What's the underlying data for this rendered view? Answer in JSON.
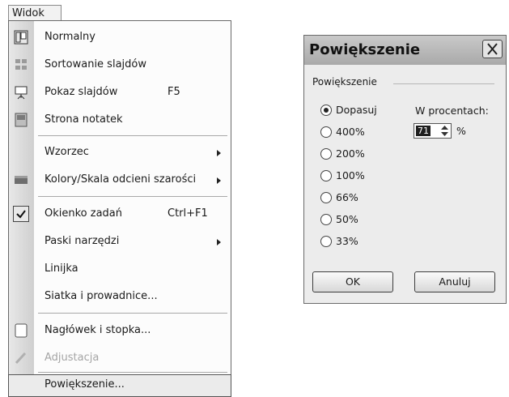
{
  "menu": {
    "title": "Widok",
    "items": [
      {
        "label": "Normalny",
        "shortcut": "",
        "submenu": false,
        "disabled": false,
        "icon": "normal-view-icon"
      },
      {
        "label": "Sortowanie slajdów",
        "shortcut": "",
        "submenu": false,
        "disabled": false,
        "icon": "slide-sorter-icon"
      },
      {
        "label": "Pokaz slajdów",
        "shortcut": "F5",
        "submenu": false,
        "disabled": false,
        "icon": "slideshow-icon"
      },
      {
        "label": "Strona notatek",
        "shortcut": "",
        "submenu": false,
        "disabled": false,
        "icon": "notes-page-icon"
      },
      {
        "label": "Wzorzec",
        "shortcut": "",
        "submenu": true,
        "disabled": false,
        "icon": ""
      },
      {
        "label": "Kolory/Skala odcieni szarości",
        "shortcut": "",
        "submenu": true,
        "disabled": false,
        "icon": "grayscale-icon"
      },
      {
        "label": "Okienko zadań",
        "shortcut": "Ctrl+F1",
        "submenu": false,
        "disabled": false,
        "checked": true,
        "icon": "checkmark-icon"
      },
      {
        "label": "Paski narzędzi",
        "shortcut": "",
        "submenu": true,
        "disabled": false,
        "icon": ""
      },
      {
        "label": "Linijka",
        "shortcut": "",
        "submenu": false,
        "disabled": false,
        "icon": ""
      },
      {
        "label": "Siatka i prowadnice...",
        "shortcut": "",
        "submenu": false,
        "disabled": false,
        "icon": ""
      },
      {
        "label": "Nagłówek i stopka...",
        "shortcut": "",
        "submenu": false,
        "disabled": false,
        "icon": "header-footer-icon"
      },
      {
        "label": "Adjustacja",
        "shortcut": "",
        "submenu": false,
        "disabled": true,
        "icon": "markup-icon"
      },
      {
        "label": "Powiększenie...",
        "shortcut": "",
        "submenu": false,
        "disabled": false,
        "highlighted": true,
        "icon": ""
      }
    ]
  },
  "dialog": {
    "title": "Powiększenie",
    "group_label": "Powiększenie",
    "radio_options": [
      {
        "label": "Dopasuj",
        "selected": true
      },
      {
        "label": "400%",
        "selected": false
      },
      {
        "label": "200%",
        "selected": false
      },
      {
        "label": "100%",
        "selected": false
      },
      {
        "label": "66%",
        "selected": false
      },
      {
        "label": "50%",
        "selected": false
      },
      {
        "label": "33%",
        "selected": false
      }
    ],
    "percent_label": "W procentach:",
    "percent_value": "71",
    "percent_sign": "%",
    "ok_label": "OK",
    "cancel_label": "Anuluj"
  }
}
